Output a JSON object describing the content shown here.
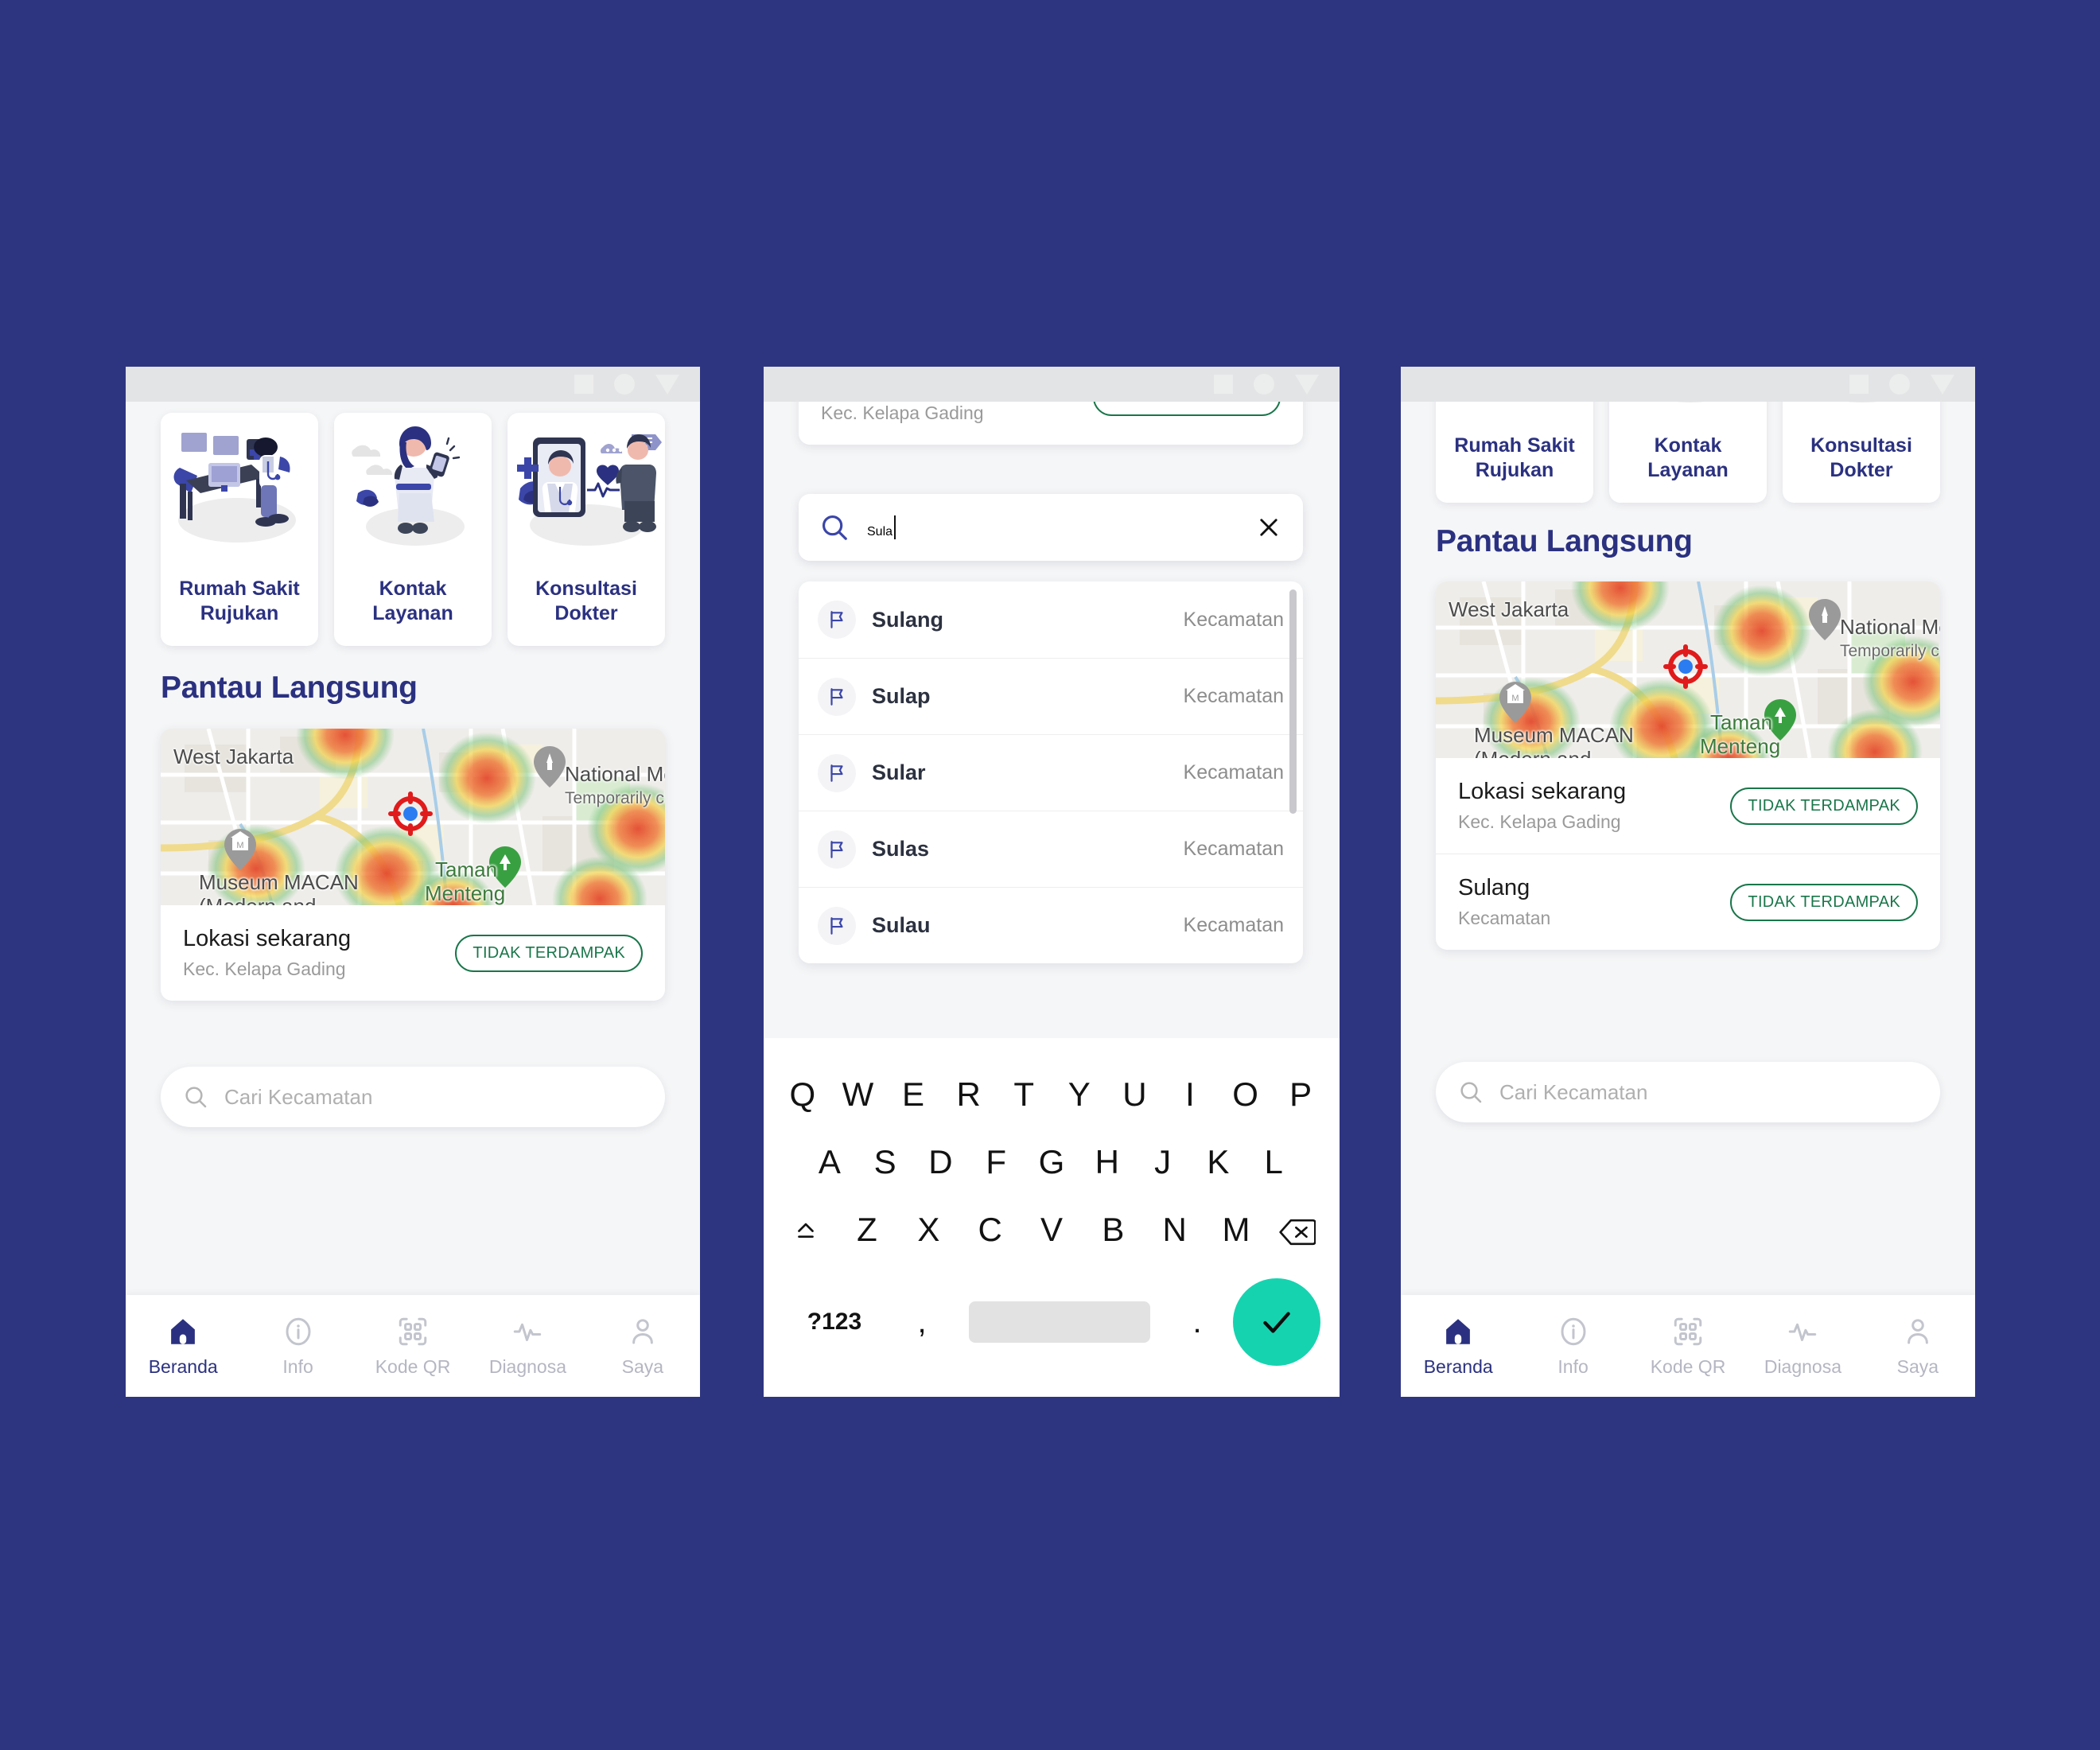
{
  "background_color": "#2e3580",
  "brand_color": "#2b3180",
  "accent_green": "#19764a",
  "keyboard_enter_color": "#16d3b0",
  "app": {
    "quick_actions": [
      {
        "label": "Rumah Sakit\nRujukan",
        "line1": "Rumah Sakit",
        "line2": "Rujukan",
        "icon": "doctor-desk-illustration"
      },
      {
        "label": "Kontak\nLayanan",
        "line1": "Kontak",
        "line2": "Layanan",
        "icon": "woman-phone-illustration"
      },
      {
        "label": "Konsultasi\nDokter",
        "line1": "Konsultasi",
        "line2": "Dokter",
        "icon": "telemedicine-illustration"
      }
    ],
    "section_title": "Pantau Langsung",
    "map": {
      "labels": [
        {
          "text": "West Jakarta",
          "style": "dark"
        },
        {
          "text": "National Mo",
          "style": "dark"
        },
        {
          "text": "Temporarily clo",
          "style": "small"
        },
        {
          "text": "Museum MACAN",
          "style": "dark"
        },
        {
          "text": "(Modern and",
          "style": "dark"
        },
        {
          "text": "Taman",
          "style": "green"
        },
        {
          "text": "Menteng",
          "style": "green"
        }
      ]
    },
    "location_card": {
      "title": "Lokasi sekarang",
      "subtitle": "Kec. Kelapa Gading",
      "status": "TIDAK TERDAMPAK"
    },
    "selected_kecamatan_card": {
      "title": "Sulang",
      "subtitle": "Kecamatan",
      "status": "TIDAK TERDAMPAK"
    },
    "search": {
      "placeholder": "Cari Kecamatan",
      "value": "Sula",
      "icon": "search-icon",
      "clear_icon": "close-icon"
    },
    "suggestions": [
      {
        "name": "Sulang",
        "type": "Kecamatan",
        "icon": "flag-icon"
      },
      {
        "name": "Sulap",
        "type": "Kecamatan",
        "icon": "flag-icon"
      },
      {
        "name": "Sular",
        "type": "Kecamatan",
        "icon": "flag-icon"
      },
      {
        "name": "Sulas",
        "type": "Kecamatan",
        "icon": "flag-icon"
      },
      {
        "name": "Sulau",
        "type": "Kecamatan",
        "icon": "flag-icon"
      }
    ],
    "bottom_nav": [
      {
        "label": "Beranda",
        "icon": "home-icon",
        "active": true
      },
      {
        "label": "Info",
        "icon": "info-icon",
        "active": false
      },
      {
        "label": "Kode QR",
        "icon": "qr-code-icon",
        "active": false
      },
      {
        "label": "Diagnosa",
        "icon": "pulse-icon",
        "active": false
      },
      {
        "label": "Saya",
        "icon": "person-icon",
        "active": false
      }
    ],
    "keyboard": {
      "row1": [
        "Q",
        "W",
        "E",
        "R",
        "T",
        "Y",
        "U",
        "I",
        "O",
        "P"
      ],
      "row2": [
        "A",
        "S",
        "D",
        "F",
        "G",
        "H",
        "J",
        "K",
        "L"
      ],
      "row3_shift": "shift-icon",
      "row3": [
        "Z",
        "X",
        "C",
        "V",
        "B",
        "N",
        "M"
      ],
      "row3_backspace": "backspace-icon",
      "row4_symbols": "?123",
      "row4_comma": ",",
      "row4_space": "",
      "row4_period": ".",
      "row4_enter": "check-icon"
    },
    "status_bar": {
      "nav_square": "square-nav-hint",
      "nav_circle": "circle-nav-hint",
      "nav_triangle": "triangle-nav-hint"
    }
  }
}
